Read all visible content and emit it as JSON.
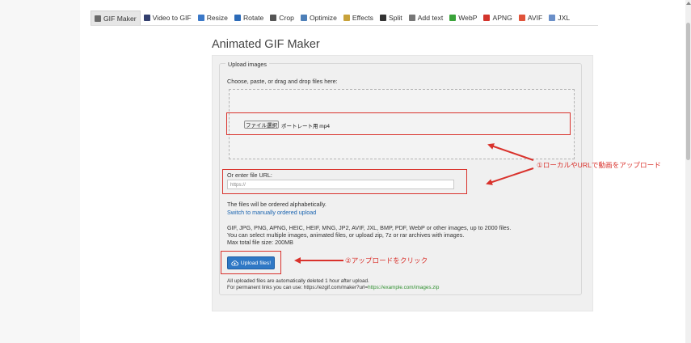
{
  "nav": {
    "items": [
      {
        "label": "GIF Maker",
        "icon": "gif-maker-icon",
        "color": "#6a6a6a",
        "active": true
      },
      {
        "label": "Video to GIF",
        "icon": "video-to-gif-icon",
        "color": "#333f6e"
      },
      {
        "label": "Resize",
        "icon": "resize-icon",
        "color": "#3a78c8"
      },
      {
        "label": "Rotate",
        "icon": "rotate-icon",
        "color": "#2c6bb8"
      },
      {
        "label": "Crop",
        "icon": "crop-icon",
        "color": "#555555"
      },
      {
        "label": "Optimize",
        "icon": "optimize-icon",
        "color": "#4d7fb8"
      },
      {
        "label": "Effects",
        "icon": "effects-icon",
        "color": "#c8a23a"
      },
      {
        "label": "Split",
        "icon": "split-icon",
        "color": "#333333"
      },
      {
        "label": "Add text",
        "icon": "add-text-icon",
        "color": "#777777"
      },
      {
        "label": "WebP",
        "icon": "webp-icon",
        "color": "#3aa33a"
      },
      {
        "label": "APNG",
        "icon": "apng-icon",
        "color": "#d3342c"
      },
      {
        "label": "AVIF",
        "icon": "avif-icon",
        "color": "#e0533a"
      },
      {
        "label": "JXL",
        "icon": "jxl-icon",
        "color": "#6a8fc8"
      }
    ]
  },
  "page_title": "Animated GIF Maker",
  "upload": {
    "legend": "Upload images",
    "choose_label": "Choose, paste, or drag and drop files here:",
    "file_button": "ファイル選択",
    "file_name": "ポートレート用 mp4",
    "url_label": "Or enter file URL:",
    "url_placeholder": "https://",
    "order_note": "The files will be ordered alphabetically.",
    "switch_link": "Switch to manually ordered upload",
    "formats_line1": "GIF, JPG, PNG, APNG, HEIC, HEIF, MNG, JP2, AVIF, JXL, BMP, PDF, WebP or other images, up to 2000 files.",
    "formats_line2": "You can select multiple images, animated files, or upload zip, 7z or rar archives with images.",
    "formats_line3": "Max total file size: 200MB",
    "upload_button": "Upload files!",
    "footnote1": "All uploaded files are automatically deleted 1 hour after upload.",
    "footnote2_prefix": "For permanent links you can use: https://ezgif.com/maker?url=",
    "footnote2_link": "https://example.com/images.zip"
  },
  "annotations": {
    "local_url": "①ローカルやURLで動画をアップロード",
    "click_upload": "②アップロードをクリック",
    "color": "#d9322c"
  }
}
